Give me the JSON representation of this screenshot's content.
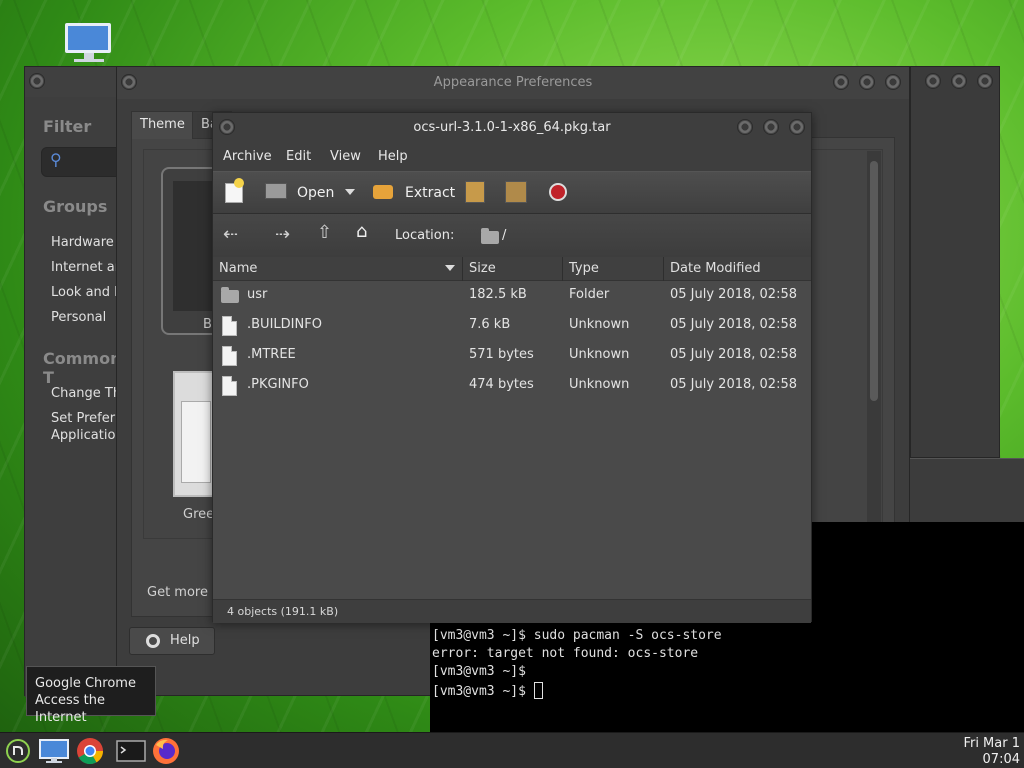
{
  "desktop": {
    "icon": "computer-icon"
  },
  "control_center": {
    "filter_label": "Filter",
    "groups_heading": "Groups",
    "groups": [
      "Hardware",
      "Internet an",
      "Look and F",
      "Personal"
    ],
    "common_heading": "Common T",
    "common": [
      "Change Th",
      "Set Preferre",
      "Application"
    ]
  },
  "appearance": {
    "title": "Appearance Preferences",
    "tabs": [
      "Theme",
      "Ba"
    ],
    "theme1_label": "B",
    "theme2_label": "Gree",
    "get_more": "Get more t",
    "help_button": "Help"
  },
  "file_roller": {
    "title": "ocs-url-3.1.0-1-x86_64.pkg.tar",
    "menu": [
      "Archive",
      "Edit",
      "View",
      "Help"
    ],
    "toolbar": {
      "open": "Open",
      "extract": "Extract"
    },
    "location_label": "Location:",
    "location_value": "/",
    "columns": [
      "Name",
      "Size",
      "Type",
      "Date Modified"
    ],
    "rows": [
      {
        "name": "usr",
        "size": "182.5 kB",
        "type": "Folder",
        "date": "05 July 2018, 02:58",
        "icon": "folder-icon"
      },
      {
        "name": ".BUILDINFO",
        "size": "7.6 kB",
        "type": "Unknown",
        "date": "05 July 2018, 02:58",
        "icon": "file-icon"
      },
      {
        "name": ".MTREE",
        "size": "571 bytes",
        "type": "Unknown",
        "date": "05 July 2018, 02:58",
        "icon": "file-icon"
      },
      {
        "name": ".PKGINFO",
        "size": "474 bytes",
        "type": "Unknown",
        "date": "05 July 2018, 02:58",
        "icon": "file-icon"
      }
    ],
    "status": "4 objects (191.1 kB)"
  },
  "terminal": {
    "lines": [
      "[vm3@vm3 ~]$ sudo pacman -S ocs-store",
      "error: target not found: ocs-store",
      "[vm3@vm3 ~]$",
      "[vm3@vm3 ~]$ "
    ]
  },
  "tooltip": {
    "line1": "Google Chrome",
    "line2": "Access the Internet"
  },
  "clock": {
    "date": "Fri Mar 1",
    "time": "07:04"
  }
}
